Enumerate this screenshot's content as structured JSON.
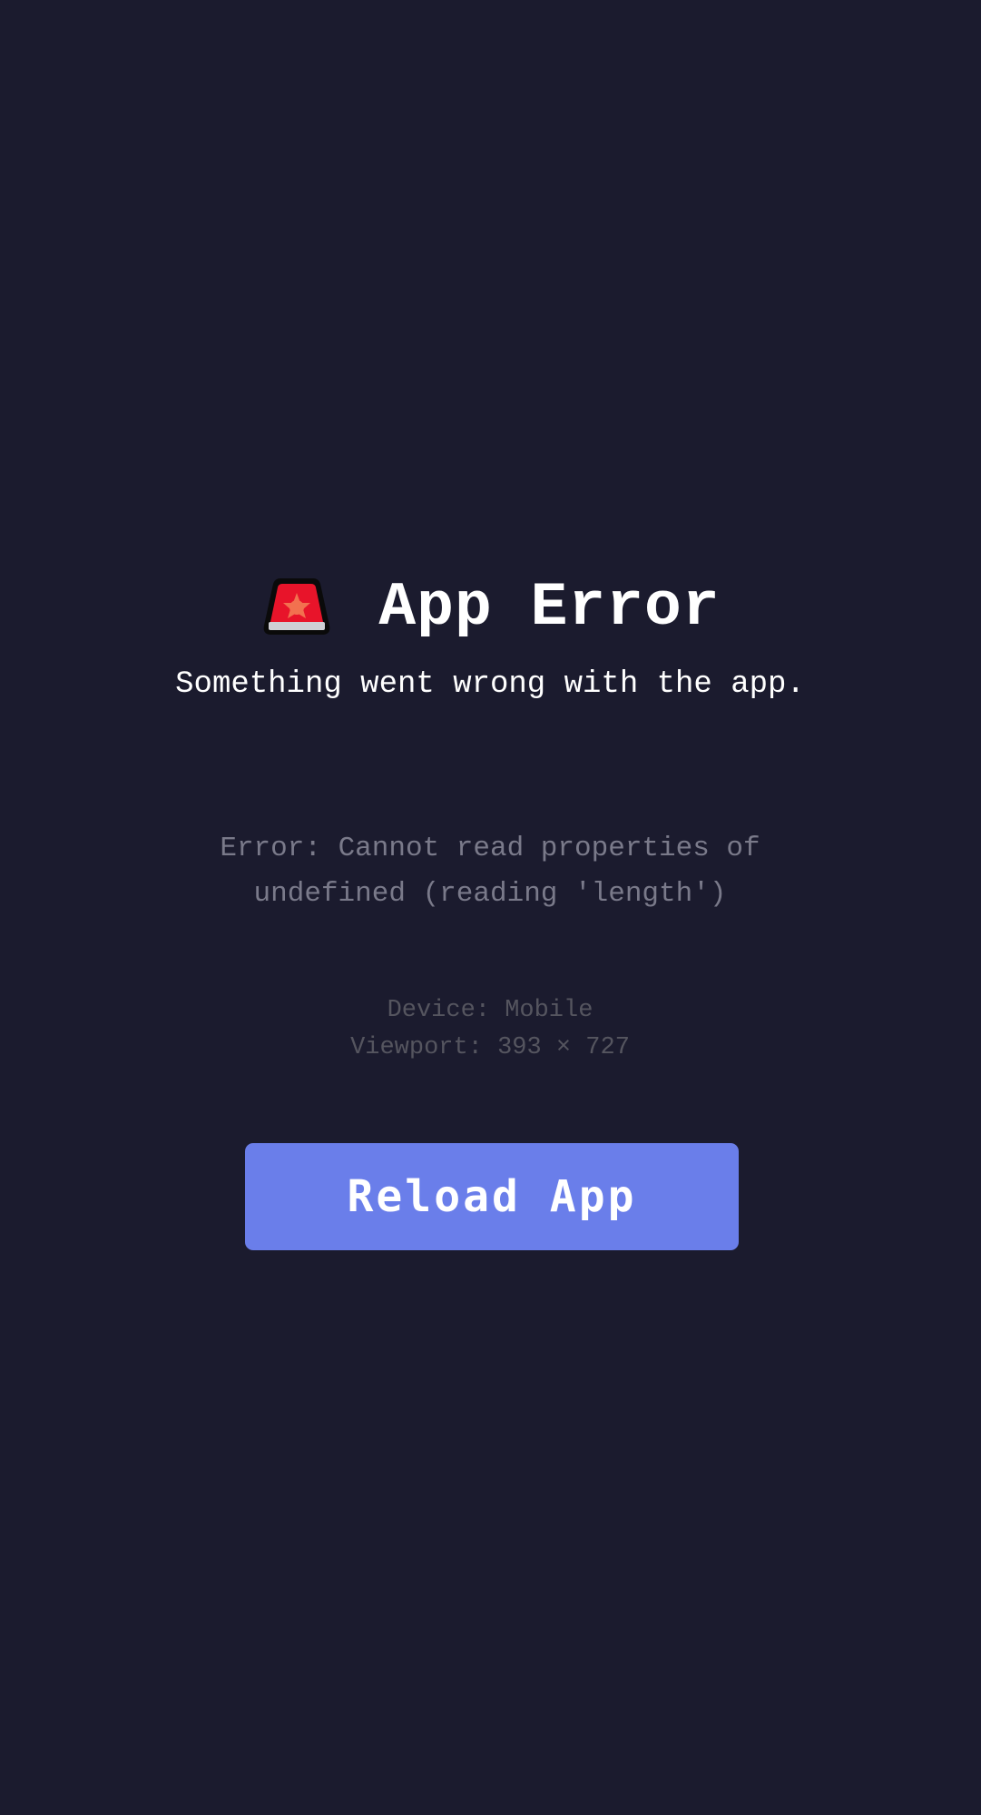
{
  "header": {
    "icon": "police-siren-icon",
    "title": "App Error"
  },
  "subtitle": "Something went wrong with the app.",
  "error": {
    "message": "Error: Cannot read properties of undefined (reading 'length')"
  },
  "device": {
    "device_line": "Device: Mobile",
    "viewport_line": "Viewport: 393 × 727"
  },
  "actions": {
    "reload_label": "Reload App"
  },
  "colors": {
    "background": "#1b1b2e",
    "accent": "#6a7eea",
    "error_text": "#7a7a8a",
    "muted_text": "#55555f"
  }
}
